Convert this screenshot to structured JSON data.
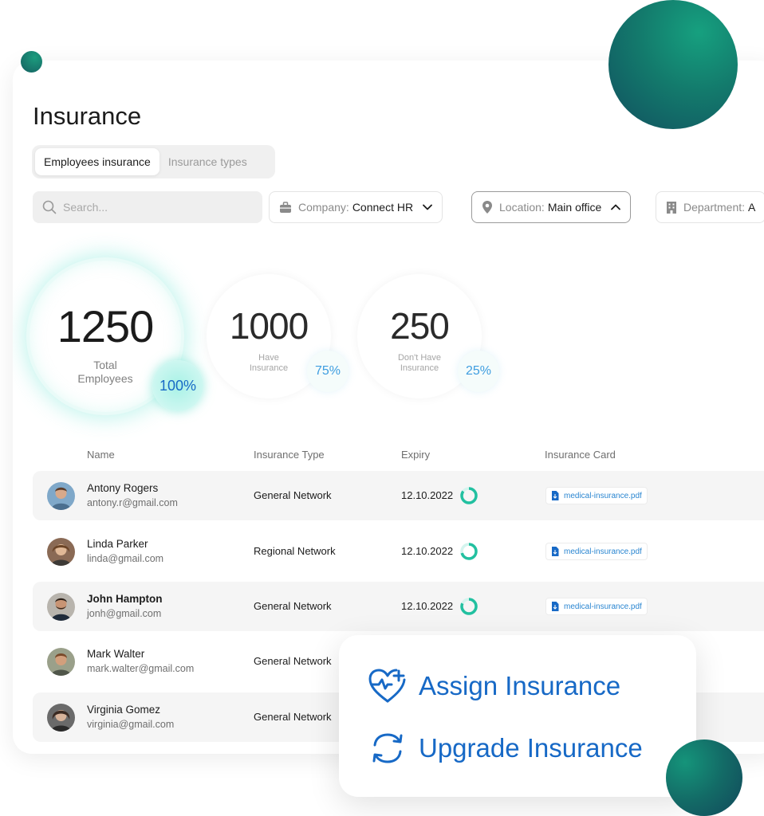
{
  "page": {
    "title": "Insurance"
  },
  "tabs": [
    {
      "label": "Employees insurance",
      "active": true
    },
    {
      "label": "Insurance types",
      "active": false
    }
  ],
  "search": {
    "placeholder": "Search..."
  },
  "filters": {
    "company": {
      "label": "Company:",
      "value": "Connect HR"
    },
    "location": {
      "label": "Location:",
      "value": "Main office"
    },
    "department": {
      "label": "Department:",
      "value": "A"
    }
  },
  "stats": {
    "total": {
      "value": "1250",
      "label_line1": "Total",
      "label_line2": "Employees",
      "percent": "100%"
    },
    "have": {
      "value": "1000",
      "label_line1": "Have",
      "label_line2": "Insurance",
      "percent": "75%"
    },
    "dont": {
      "value": "250",
      "label_line1": "Don't Have",
      "label_line2": "Insurance",
      "percent": "25%"
    }
  },
  "table": {
    "headers": {
      "name": "Name",
      "type": "Insurance Type",
      "expiry": "Expiry",
      "card": "Insurance Card"
    },
    "rows": [
      {
        "name": "Antony Rogers",
        "email": "antony.r@gmail.com",
        "type": "General Network",
        "expiry": "12.10.2022",
        "card": "medical-insurance.pdf"
      },
      {
        "name": "Linda Parker",
        "email": "linda@gmail.com",
        "type": "Regional Network",
        "expiry": "12.10.2022",
        "card": "medical-insurance.pdf"
      },
      {
        "name": "John Hampton",
        "email": "jonh@gmail.com",
        "type": "General Network",
        "expiry": "12.10.2022",
        "card": "medical-insurance.pdf"
      },
      {
        "name": "Mark Walter",
        "email": "mark.walter@gmail.com",
        "type": "General Network"
      },
      {
        "name": "Virginia Gomez",
        "email": "virginia@gmail.com",
        "type": "General Network"
      }
    ]
  },
  "actions": {
    "assign": "Assign Insurance",
    "upgrade": "Upgrade Insurance"
  },
  "colors": {
    "accent_blue": "#1769c6",
    "teal": "#16a07f",
    "dark_teal": "#114f5f"
  },
  "icons": [
    "search-icon",
    "briefcase-icon",
    "location-pin-icon",
    "building-icon",
    "chevron-down-icon",
    "chevron-up-icon",
    "pdf-file-icon",
    "heart-plus-icon",
    "refresh-icon"
  ]
}
